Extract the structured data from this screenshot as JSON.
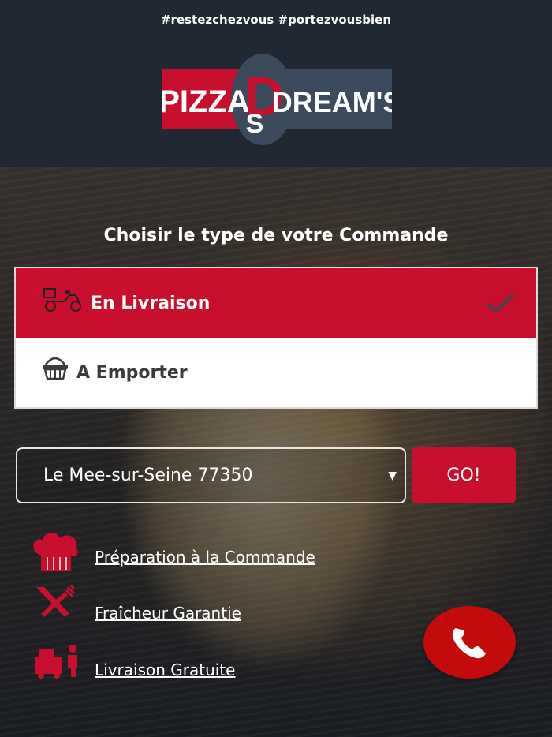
{
  "header": {
    "hashtags": "#restezchezvous #portezvousbien",
    "logo_left": "PIZZA",
    "logo_right": "DREAM'S",
    "logo_mark_top": "D",
    "logo_mark_bottom": "S"
  },
  "order": {
    "title": "Choisir le type de votre Commande",
    "options": [
      {
        "label": "En Livraison",
        "selected": true,
        "icon": "delivery-scooter-icon"
      },
      {
        "label": "A Emporter",
        "selected": false,
        "icon": "basket-icon"
      }
    ]
  },
  "location": {
    "selected_city": "Le Mee-sur-Seine 77350",
    "go_label": "GO!"
  },
  "features": [
    {
      "label": "Préparation à la Commande",
      "icon": "chef-hat-icon"
    },
    {
      "label": "Fraîcheur Garantie",
      "icon": "knife-fork-icon"
    },
    {
      "label": "Livraison Gratuite",
      "icon": "delivery-man-icon"
    }
  ],
  "call": {
    "icon": "phone-icon"
  },
  "colors": {
    "accent": "#c8102e",
    "header_bg": "#1f2833",
    "logo_blue": "#3b4a5c",
    "call_red": "#c40b0b"
  }
}
